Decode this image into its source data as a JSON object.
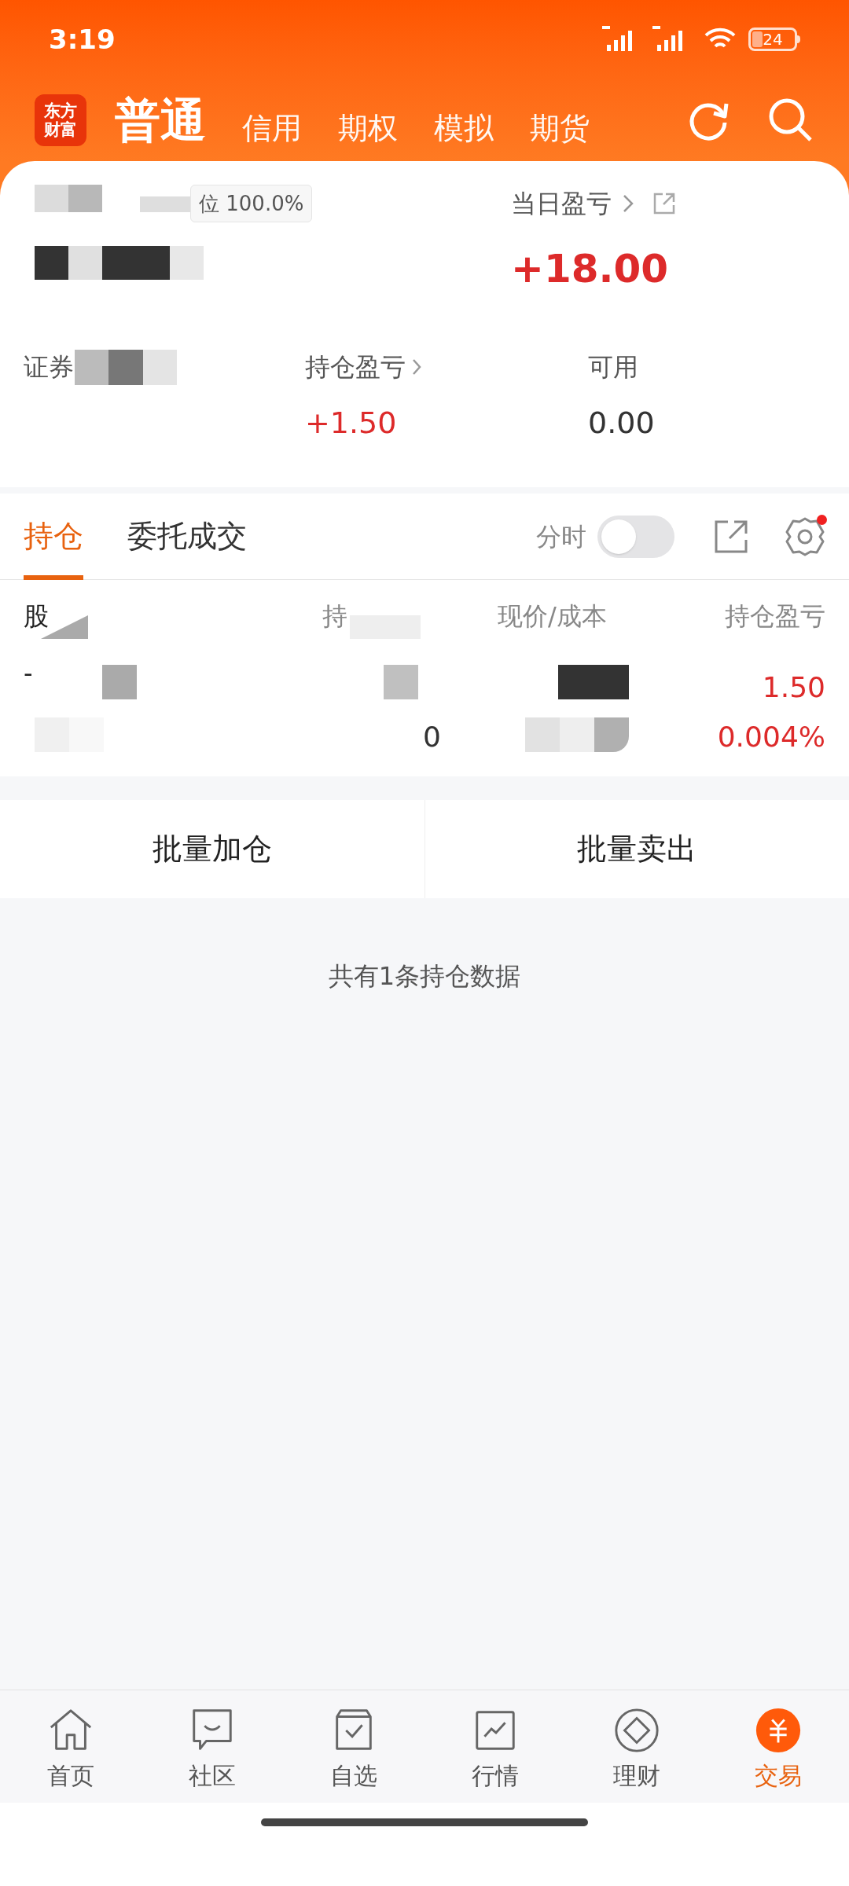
{
  "status_bar": {
    "time": "3:19",
    "battery": "24"
  },
  "header": {
    "logo": [
      "东方",
      "财富"
    ],
    "tabs": [
      {
        "label": "普通",
        "selected": true
      },
      {
        "label": "信用",
        "selected": false
      },
      {
        "label": "期权",
        "selected": false
      },
      {
        "label": "模拟",
        "selected": false
      },
      {
        "label": "期货",
        "selected": false
      }
    ]
  },
  "account": {
    "position_ratio": "位 100.0%",
    "daily_pnl_label": "当日盈亏",
    "daily_pnl": "+18.00",
    "market_value_label": "证券",
    "holding_pnl_label": "持仓盈亏",
    "holding_pnl": "+1.50",
    "available_label": "可用",
    "available": "0.00"
  },
  "section_tabs": [
    {
      "label": "持仓",
      "selected": true
    },
    {
      "label": "委托成交",
      "selected": false
    }
  ],
  "intraday": {
    "label": "分时",
    "on": false
  },
  "settings_badge": true,
  "table": {
    "columns": [
      "股",
      "持",
      "现价/成本",
      "持仓盈亏"
    ],
    "rows": [
      {
        "column_1": "-",
        "column_4": "1.50",
        "column_2b": "0",
        "column_4b": "0.004%"
      }
    ]
  },
  "buttons": [
    "批量加仓",
    "批量卖出"
  ],
  "summary": "共有1条持仓数据",
  "bottom_nav": [
    {
      "label": "首页",
      "selected": false
    },
    {
      "label": "社区",
      "selected": false
    },
    {
      "label": "自选",
      "selected": false
    },
    {
      "label": "行情",
      "selected": false
    },
    {
      "label": "理财",
      "selected": false
    },
    {
      "label": "交易",
      "selected": true
    }
  ]
}
